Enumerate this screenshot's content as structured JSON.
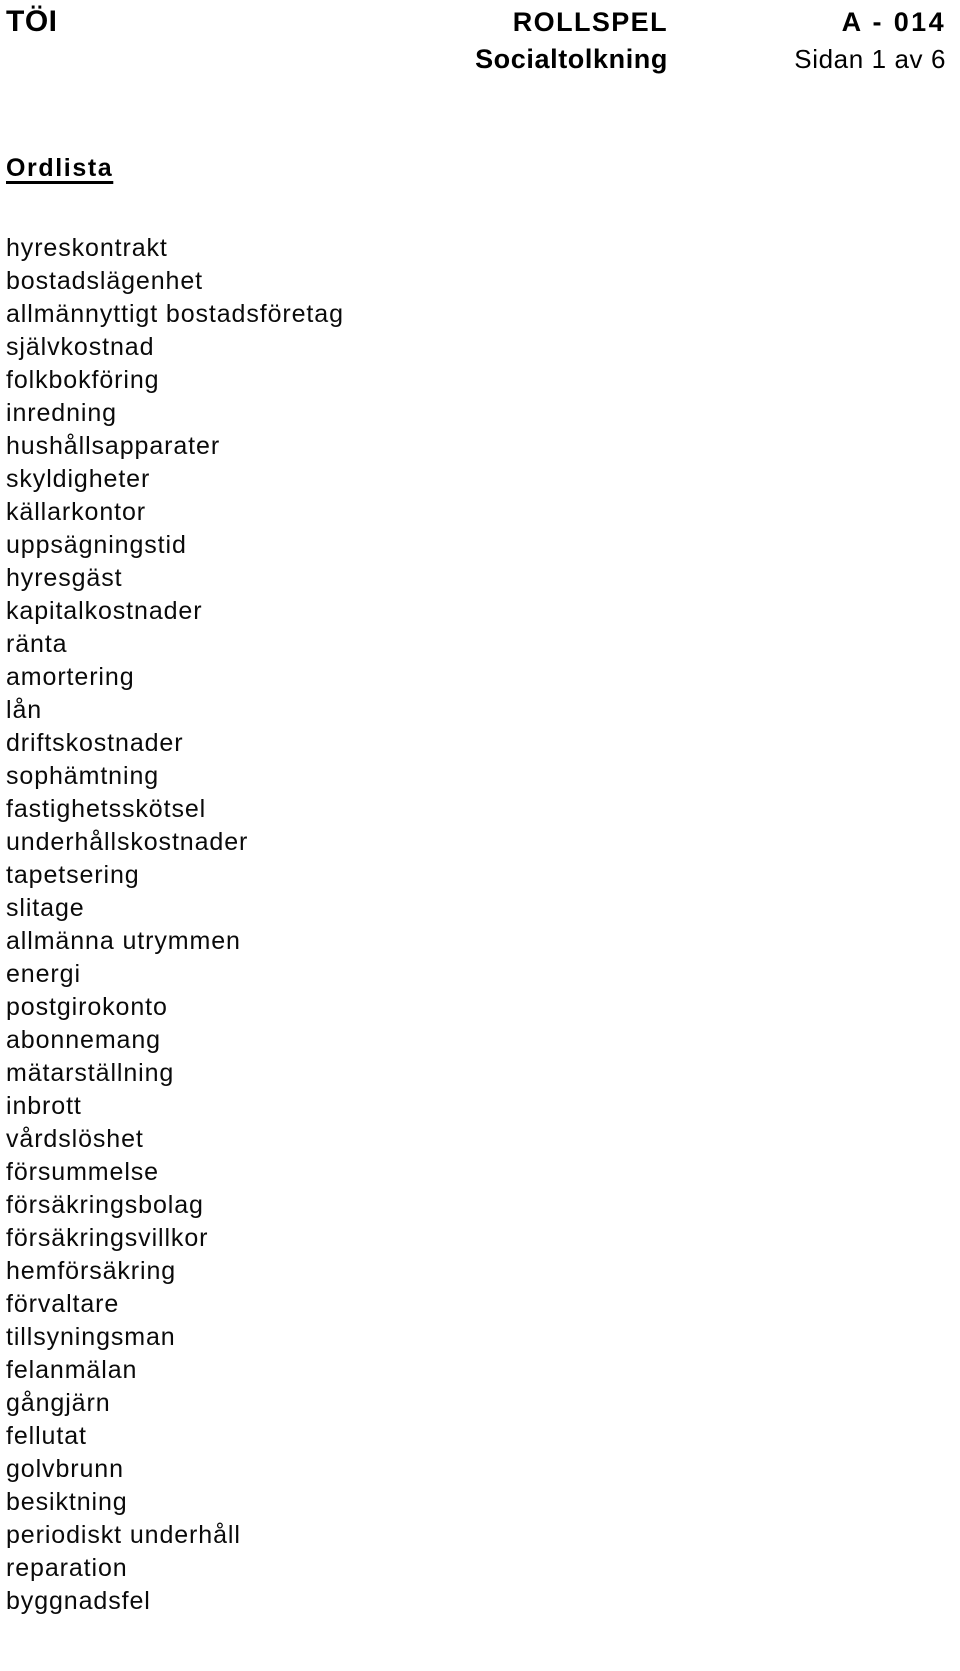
{
  "header": {
    "organization": "TÖI",
    "document_type": "ROLLSPEL",
    "subject": "Socialtolkning",
    "document_code": "A - 014",
    "page_info": "Sidan 1 av 6"
  },
  "section": {
    "heading": "Ordlista"
  },
  "words": [
    "hyreskontrakt",
    "bostadslägenhet",
    "allmännyttigt bostadsföretag",
    "självkostnad",
    "folkbokföring",
    "inredning",
    "hushållsapparater",
    "skyldigheter",
    "källarkontor",
    "uppsägningstid",
    "hyresgäst",
    "kapitalkostnader",
    "ränta",
    "amortering",
    "lån",
    "driftskostnader",
    "sophämtning",
    "fastighetsskötsel",
    "underhållskostnader",
    "tapetsering",
    "slitage",
    "allmänna utrymmen",
    "energi",
    "postgirokonto",
    "abonnemang",
    "mätarställning",
    "inbrott",
    "vårdslöshet",
    "försummelse",
    "försäkringsbolag",
    "försäkringsvillkor",
    "hemförsäkring",
    "förvaltare",
    "tillsyningsman",
    "felanmälan",
    "gångjärn",
    "fellutat",
    "golvbrunn",
    "besiktning",
    "periodiskt underhåll",
    "reparation",
    "byggnadsfel"
  ],
  "colors": {
    "text": "#000000",
    "background": "#ffffff"
  }
}
